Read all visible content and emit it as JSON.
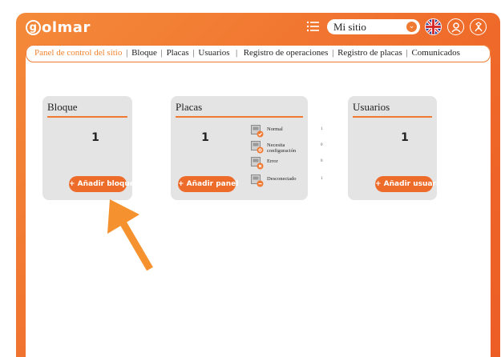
{
  "header": {
    "logo_text": "olmar",
    "logo_letter": "g",
    "site_select": {
      "value": "Mi sitio"
    },
    "icons": [
      "menu-icon",
      "uk-flag-icon",
      "user-icon",
      "logout-icon"
    ]
  },
  "tabs": [
    {
      "label": "Panel de control del sitio",
      "active": true
    },
    {
      "label": "Bloque"
    },
    {
      "label": "Placas"
    },
    {
      "label": "Usuarios"
    },
    {
      "label": "Registro de operaciones"
    },
    {
      "label": "Registro de placas"
    },
    {
      "label": "Comunicados"
    }
  ],
  "cards": {
    "bloque": {
      "title": "Bloque",
      "value": "1",
      "button": "+ Añadir bloques"
    },
    "placas": {
      "title": "Placas",
      "value": "1",
      "button": "+ Añadir panel",
      "statuses": [
        {
          "label": "Normal",
          "count": "1"
        },
        {
          "label": "Necesita configuración",
          "count": "0"
        },
        {
          "label": "Error",
          "count": "0"
        },
        {
          "label": "Desconectado",
          "count": "1"
        }
      ]
    },
    "usuarios": {
      "title": "Usuarios",
      "value": "1",
      "button": "+ Añadir usuario"
    }
  },
  "colors": {
    "accent": "#f07a32",
    "card_bg": "#e4e4e4",
    "arrow": "#f5922f"
  }
}
